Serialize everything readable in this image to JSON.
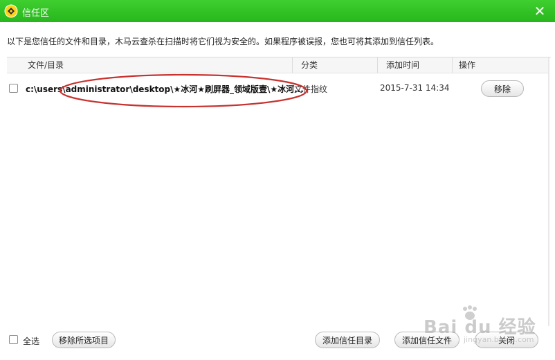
{
  "window": {
    "title": "信任区",
    "close_glyph": "✕",
    "accent_color": "#2fbf22"
  },
  "description": "以下是您信任的文件和目录，木马云查杀在扫描时将它们视为安全的。如果程序被误报，您也可将其添加到信任列表。",
  "table": {
    "columns": [
      "文件/目录",
      "分类",
      "添加时间",
      "操作"
    ],
    "rows": [
      {
        "path": "c:\\users\\administrator\\desktop\\★冰河★刷屏器_领域版壹\\★冰河...",
        "category": "文件指纹",
        "time": "2015-7-31 14:34",
        "action": "移除",
        "checked": false
      }
    ]
  },
  "footer": {
    "select_all_label": "全选",
    "remove_selected": "移除所选项目",
    "add_trusted_dir": "添加信任目录",
    "add_trusted_file": "添加信任文件",
    "close": "关闭"
  },
  "watermark": {
    "brand": "Bai du 经验",
    "sub": "jingyan.baidu.com"
  },
  "icons": {
    "app": "trojan-shield-icon",
    "close": "close-icon"
  }
}
